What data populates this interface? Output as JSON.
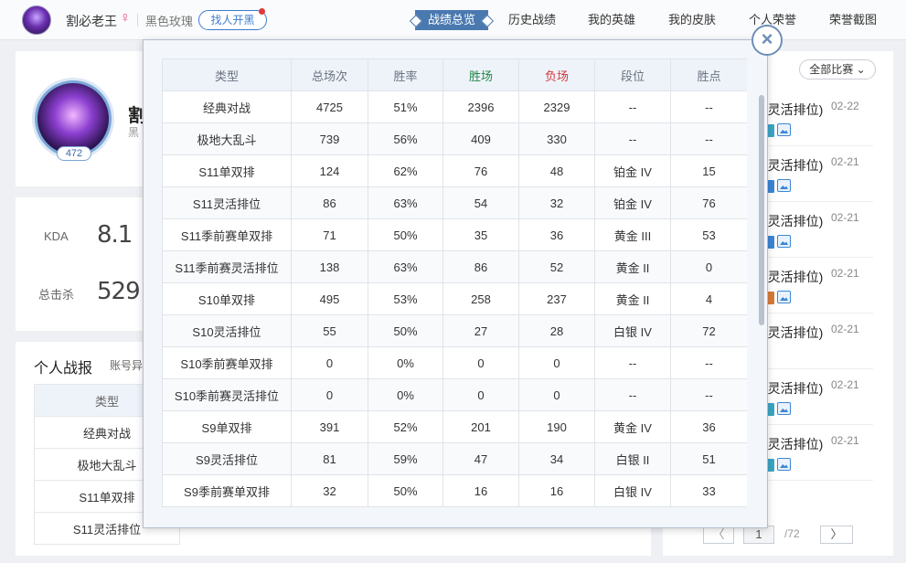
{
  "topbar": {
    "username": "割必老王",
    "gender_icon": "female-icon",
    "server": "黑色玫瑰",
    "find_team": "找人开黑",
    "nav": [
      "战绩总览",
      "历史战绩",
      "我的英雄",
      "我的皮肤",
      "个人荣誉",
      "荣誉截图"
    ],
    "active_nav": "战绩总览"
  },
  "profile": {
    "name": "割",
    "server_short": "黑",
    "level": "472"
  },
  "stats": {
    "kda_label": "KDA",
    "kda_value": "8.1",
    "kills_label": "总击杀",
    "kills_value": "529"
  },
  "section": {
    "title": "个人战报",
    "subtitle": "账号异"
  },
  "bg_table": {
    "header": "类型",
    "rows": [
      "经典对战",
      "极地大乱斗",
      "S11单双排",
      "S11灵活排位"
    ]
  },
  "right_panel": {
    "filter": "全部比赛",
    "matches": [
      {
        "title": "(灵活排位)",
        "date": "02-22"
      },
      {
        "title": "(灵活排位)",
        "date": "02-21"
      },
      {
        "title": "(灵活排位)",
        "date": "02-21"
      },
      {
        "title": "(灵活排位)",
        "date": "02-21"
      },
      {
        "title": "(灵活排位)",
        "date": "02-21"
      },
      {
        "title": "(灵活排位)",
        "date": "02-21"
      },
      {
        "title": "(灵活排位)",
        "date": "02-21"
      }
    ],
    "pager": {
      "prev": "〈",
      "current": "1",
      "total": "/72",
      "next": "〉"
    }
  },
  "modal": {
    "close_icon": "close-icon",
    "close_label": "×",
    "columns": [
      "类型",
      "总场次",
      "胜率",
      "胜场",
      "负场",
      "段位",
      "胜点"
    ],
    "rows": [
      [
        "经典对战",
        "4725",
        "51%",
        "2396",
        "2329",
        "--",
        "--"
      ],
      [
        "极地大乱斗",
        "739",
        "56%",
        "409",
        "330",
        "--",
        "--"
      ],
      [
        "S11单双排",
        "124",
        "62%",
        "76",
        "48",
        "铂金 IV",
        "15"
      ],
      [
        "S11灵活排位",
        "86",
        "63%",
        "54",
        "32",
        "铂金 IV",
        "76"
      ],
      [
        "S11季前赛单双排",
        "71",
        "50%",
        "35",
        "36",
        "黄金 III",
        "53"
      ],
      [
        "S11季前赛灵活排位",
        "138",
        "63%",
        "86",
        "52",
        "黄金 II",
        "0"
      ],
      [
        "S10单双排",
        "495",
        "53%",
        "258",
        "237",
        "黄金 II",
        "4"
      ],
      [
        "S10灵活排位",
        "55",
        "50%",
        "27",
        "28",
        "白银 IV",
        "72"
      ],
      [
        "S10季前赛单双排",
        "0",
        "0%",
        "0",
        "0",
        "--",
        "--"
      ],
      [
        "S10季前赛灵活排位",
        "0",
        "0%",
        "0",
        "0",
        "--",
        "--"
      ],
      [
        "S9单双排",
        "391",
        "52%",
        "201",
        "190",
        "黄金 IV",
        "36"
      ],
      [
        "S9灵活排位",
        "81",
        "59%",
        "47",
        "34",
        "白银 II",
        "51"
      ],
      [
        "S9季前赛单双排",
        "32",
        "50%",
        "16",
        "16",
        "白银 IV",
        "33"
      ]
    ]
  },
  "colors": {
    "accent": "#4a79b0",
    "win": "#21884a",
    "loss": "#d5393a"
  }
}
